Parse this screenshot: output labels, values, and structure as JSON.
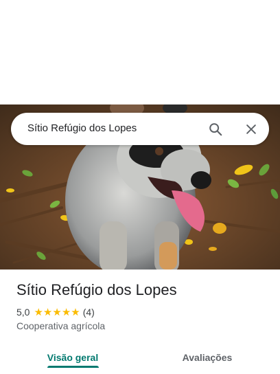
{
  "search": {
    "query": "Sítio Refúgio dos Lopes"
  },
  "place": {
    "title": "Sítio Refúgio dos Lopes",
    "rating": "5,0",
    "stars": 5,
    "review_count": "(4)",
    "category": "Cooperativa agrícola"
  },
  "tabs": [
    {
      "label": "Visão geral",
      "active": true
    },
    {
      "label": "Avaliações",
      "active": false
    }
  ],
  "colors": {
    "accent": "#01796f",
    "star": "#fbbc04",
    "text_primary": "#202124",
    "text_secondary": "#5f6368"
  },
  "icons": {
    "search": "search-icon",
    "close": "close-icon",
    "star": "star-icon"
  }
}
